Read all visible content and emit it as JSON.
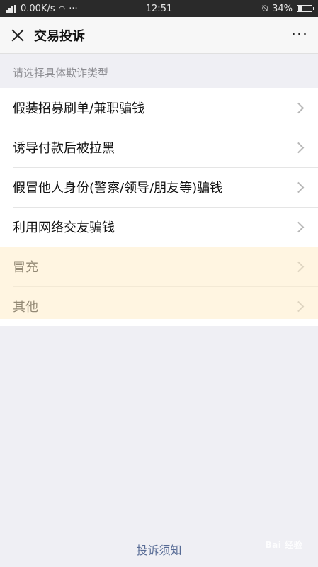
{
  "status_bar": {
    "network_speed": "0.00K/s",
    "dots": "···",
    "time": "12:51",
    "battery_text": "34%",
    "battery_level": 0.34
  },
  "nav": {
    "title": "交易投诉",
    "more": "···"
  },
  "hint": "请选择具体欺诈类型",
  "items": [
    {
      "label": "假装招募刷单/兼职骗钱"
    },
    {
      "label": "诱导付款后被拉黑"
    },
    {
      "label": "假冒他人身份(警察/领导/朋友等)骗钱"
    },
    {
      "label": "利用网络交友骗钱"
    },
    {
      "label": "冒充"
    },
    {
      "label": "其他"
    }
  ],
  "footer_link": "投诉须知",
  "watermark": "Bai 经验"
}
